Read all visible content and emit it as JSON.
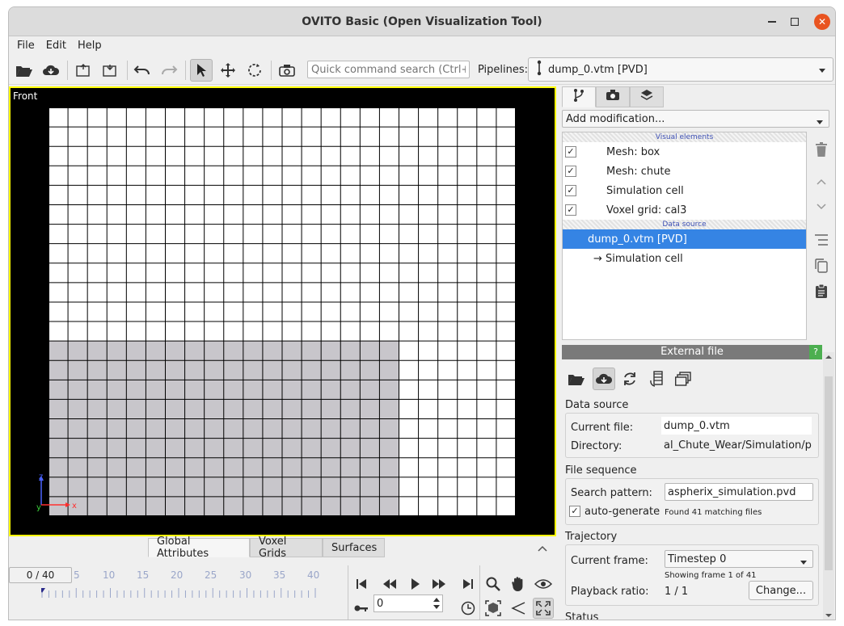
{
  "window": {
    "title": "OVITO Basic (Open Visualization Tool)"
  },
  "menu": {
    "items": [
      "File",
      "Edit",
      "Help"
    ]
  },
  "toolbar": {
    "search_placeholder": "Quick command search (Ctrl+Q)",
    "pipelines_label": "Pipelines:",
    "pipeline_selected": "dump_0.vtm [PVD]"
  },
  "viewport": {
    "label": "Front",
    "grid": {
      "cols": 24,
      "rows": 21,
      "shaded_cols": 18,
      "shaded_rows": 9
    },
    "axis": {
      "z": "z",
      "y": "y",
      "x": "x"
    },
    "colors": {
      "border": "#ffff00",
      "shaded": "#c8c6cb",
      "background": "#000000"
    }
  },
  "bottom": {
    "tabs": [
      "Global Attributes",
      "Voxel Grids",
      "Surfaces"
    ],
    "frame_display": "0 / 40",
    "ticks": [
      "5",
      "10",
      "15",
      "20",
      "25",
      "30",
      "35",
      "40"
    ],
    "frame_spin_value": "0"
  },
  "right": {
    "add_modification": "Add modification...",
    "visual_elements_header": "Visual elements",
    "visual_elements": [
      {
        "label": "Mesh: box",
        "check": "✓"
      },
      {
        "label": "Mesh: chute",
        "check": "✓"
      },
      {
        "label": "Simulation cell",
        "check": "✓"
      },
      {
        "label": "Voxel grid: cal3",
        "check": "✓"
      }
    ],
    "data_source_header": "Data source",
    "data_source_item": "dump_0.vtm [PVD]",
    "data_source_child": "→ Simulation cell",
    "external_file": {
      "title": "External file",
      "help": "?",
      "data_source_title": "Data source",
      "current_file_label": "Current file:",
      "current_file_value": "dump_0.vtm",
      "directory_label": "Directory:",
      "directory_value": "al_Chute_Wear/Simulation/post",
      "file_sequence_title": "File sequence",
      "search_pattern_label": "Search pattern:",
      "search_pattern_value": "aspherix_simulation.pvd",
      "auto_generate_label": "auto-generate",
      "auto_generate_check": "✓",
      "found_files": "Found 41 matching files",
      "trajectory_title": "Trajectory",
      "current_frame_label": "Current frame:",
      "current_frame_value": "Timestep 0",
      "showing_frame": "Showing frame 1 of 41",
      "playback_ratio_label": "Playback ratio:",
      "playback_ratio_value": "1 / 1",
      "change_button": "Change...",
      "status_title": "Status"
    }
  }
}
